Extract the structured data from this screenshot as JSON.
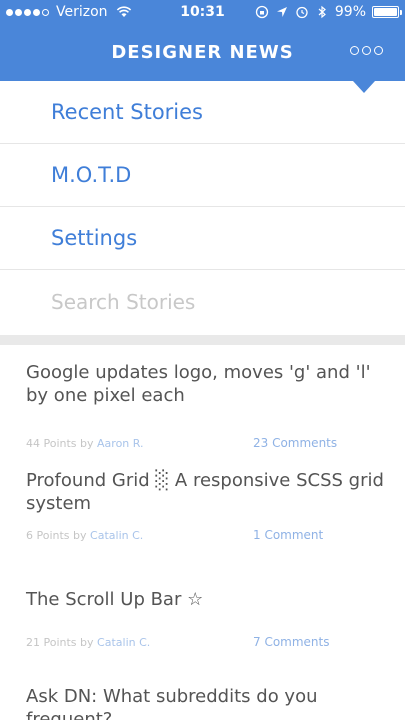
{
  "status_bar": {
    "carrier": "Verizon",
    "time": "10:31",
    "battery": "99%",
    "battery_level": 0.99
  },
  "header": {
    "title": "DESIGNER NEWS"
  },
  "menu": {
    "items": [
      {
        "label": "Recent Stories"
      },
      {
        "label": "M.O.T.D"
      },
      {
        "label": "Settings"
      }
    ],
    "search_placeholder": "Search Stories"
  },
  "stories": [
    {
      "title": "Google updates logo, moves 'g' and 'l' by one pixel each",
      "points": "44 Points by",
      "author": "Aaron R.",
      "comments": "23 Comments"
    },
    {
      "title": "Profound Grid ░ A responsive SCSS grid system",
      "points": "6 Points by",
      "author": "Catalin C.",
      "comments": "1 Comment"
    },
    {
      "title": "The Scroll Up Bar ☆",
      "points": "21 Points by",
      "author": "Catalin C.",
      "comments": "7 Comments"
    },
    {
      "title": "Ask DN: What subreddits do you frequent?"
    }
  ],
  "colors": {
    "header": "#4a86d9",
    "link": "#3f7ed8"
  }
}
